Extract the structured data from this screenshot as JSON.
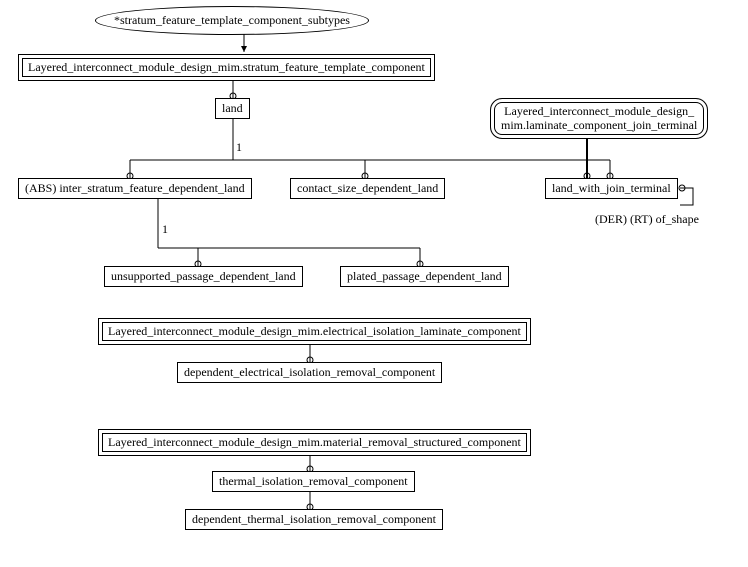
{
  "nodes": {
    "top_ellipse": "*stratum_feature_template_component_subtypes",
    "stratum_feature_box": "Layered_interconnect_module_design_mim.stratum_feature_template_component",
    "land": "land",
    "laminate_join_terminal": "Layered_interconnect_module_design_\nmim.laminate_component_join_terminal",
    "abs_inter_stratum": "(ABS) inter_stratum_feature_dependent_land",
    "contact_size": "contact_size_dependent_land",
    "land_with_join": "land_with_join_terminal",
    "der_label": "(DER) (RT) of_shape",
    "unsupported_passage": "unsupported_passage_dependent_land",
    "plated_passage": "plated_passage_dependent_land",
    "elec_iso_box": "Layered_interconnect_module_design_mim.electrical_isolation_laminate_component",
    "dep_elec_iso": "dependent_electrical_isolation_removal_component",
    "material_removal_box": "Layered_interconnect_module_design_mim.material_removal_structured_component",
    "thermal_iso": "thermal_isolation_removal_component",
    "dep_thermal_iso": "dependent_thermal_isolation_removal_component",
    "one_a": "1",
    "one_b": "1"
  }
}
